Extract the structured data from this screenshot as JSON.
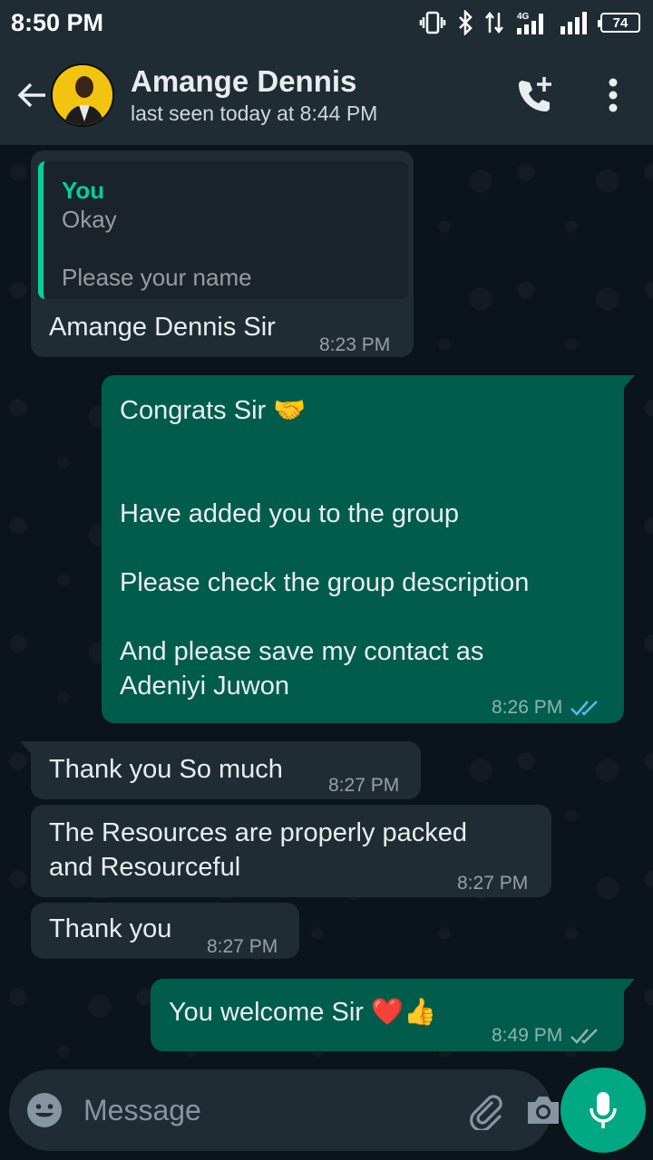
{
  "status_bar": {
    "time": "8:50 PM",
    "network": "4G",
    "battery": "74"
  },
  "header": {
    "contact_name": "Amange Dennis",
    "contact_status": "last seen today at 8:44 PM"
  },
  "messages": [
    {
      "direction": "in",
      "quote": {
        "author": "You",
        "lines": [
          "Okay",
          "",
          "Please your name"
        ]
      },
      "text": "Amange Dennis Sir",
      "time": "8:23 PM"
    },
    {
      "direction": "out",
      "lines": [
        "Congrats Sir 🤝",
        "",
        "",
        "Have added you to the group",
        "",
        "Please check the group description",
        "",
        "And please save my contact as",
        "Adeniyi Juwon"
      ],
      "time": "8:26 PM",
      "status": "read"
    },
    {
      "direction": "in",
      "text": "Thank you So much",
      "time": "8:27 PM"
    },
    {
      "direction": "in",
      "lines": [
        "The Resources are properly packed",
        "and Resourceful"
      ],
      "time": "8:27 PM"
    },
    {
      "direction": "in",
      "text": "Thank you",
      "time": "8:27 PM"
    },
    {
      "direction": "out",
      "text": "You welcome Sir ❤️👍",
      "time": "8:49 PM",
      "status": "delivered"
    }
  ],
  "composer": {
    "placeholder": "Message"
  },
  "colors": {
    "header_bg": "#1f2c34",
    "chat_bg": "#0b141a",
    "incoming_bubble": "#1f2c34",
    "outgoing_bubble": "#005c4b",
    "accent": "#00a884",
    "read_tick": "#53bdeb"
  }
}
